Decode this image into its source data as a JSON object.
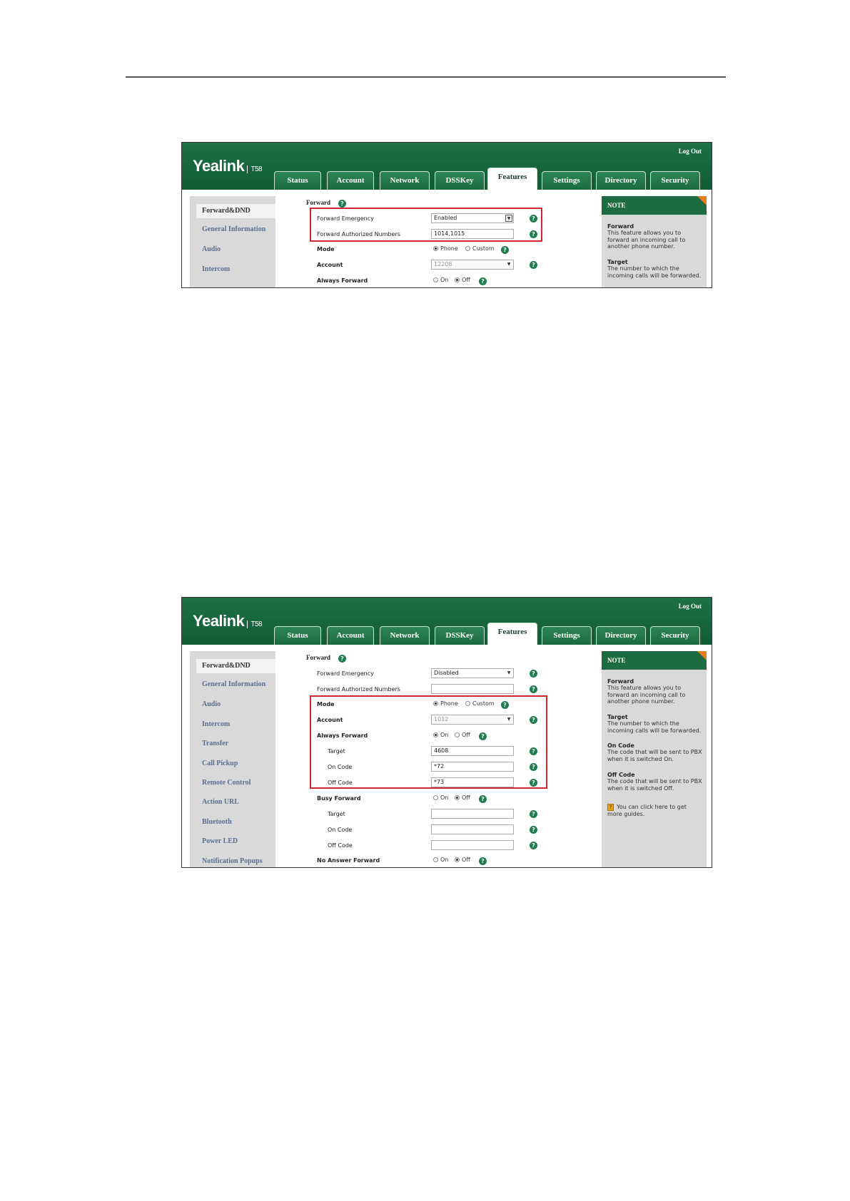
{
  "brand": {
    "logo": "Yealink",
    "model": "T58",
    "logout": "Log Out"
  },
  "tabs": [
    "Status",
    "Account",
    "Network",
    "DSSKey",
    "Features",
    "Settings",
    "Directory",
    "Security"
  ],
  "section_title": "Forward",
  "note": {
    "heading": "NOTE",
    "forward_title": "Forward",
    "forward_text": "This feature allows you to forward an incoming call to another phone number.",
    "target_title": "Target",
    "target_text": "The number to which the incoming calls will be forwarded.",
    "oncode_title": "On Code",
    "oncode_text": "The code that will be sent to PBX when it is switched On.",
    "offcode_title": "Off Code",
    "offcode_text": "The code that will be sent to PBX when it is switched Off.",
    "tip_text": "You can click here to get more guides."
  },
  "shot1": {
    "sidebar": [
      "Forward&DND",
      "General Information",
      "Audio",
      "Intercom"
    ],
    "fields": {
      "forward_emergency_label": "Forward Emergency",
      "forward_emergency_value": "Enabled",
      "authorized_label": "Forward Authorized Numbers",
      "authorized_value": "1014,1015",
      "mode_label": "Mode",
      "mode_phone": "Phone",
      "mode_custom": "Custom",
      "account_label": "Account",
      "account_value": "12208",
      "always_forward_label": "Always Forward",
      "on": "On",
      "off": "Off"
    }
  },
  "shot2": {
    "sidebar": [
      "Forward&DND",
      "General Information",
      "Audio",
      "Intercom",
      "Transfer",
      "Call Pickup",
      "Remote Control",
      "Action URL",
      "Bluetooth",
      "Power LED",
      "Notification Popups"
    ],
    "fields": {
      "forward_emergency_label": "Forward Emergency",
      "forward_emergency_value": "Disabled",
      "authorized_label": "Forward Authorized Numbers",
      "authorized_value": "",
      "mode_label": "Mode",
      "mode_phone": "Phone",
      "mode_custom": "Custom",
      "account_label": "Account",
      "account_value": "1012",
      "always_forward_label": "Always Forward",
      "target_label": "Target",
      "target_value": "4608",
      "oncode_label": "On Code",
      "oncode_value": "*72",
      "offcode_label": "Off Code",
      "offcode_value": "*73",
      "busy_forward_label": "Busy Forward",
      "busy_target_label": "Target",
      "busy_oncode_label": "On Code",
      "busy_offcode_label": "Off Code",
      "no_answer_label": "No Answer Forward",
      "on": "On",
      "off": "Off"
    }
  }
}
